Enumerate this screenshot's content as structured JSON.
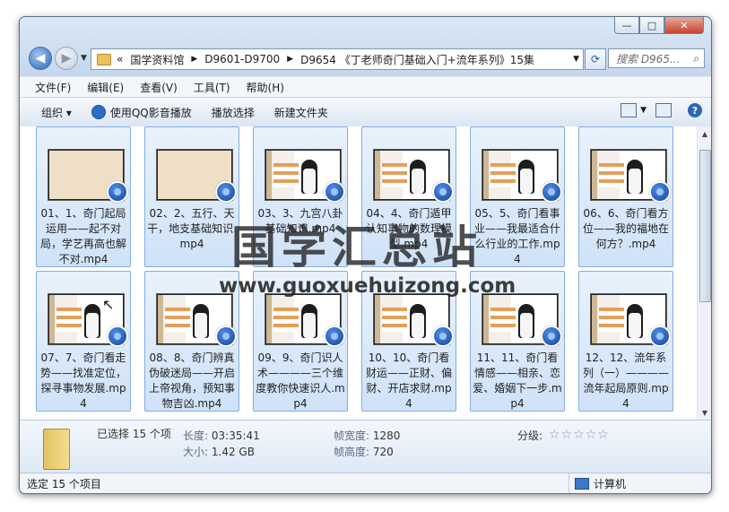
{
  "address": {
    "segments": [
      "«",
      "国学资料馆",
      "D9601-D9700",
      "D9654 《丁老师奇门基础入门+流年系列》15集"
    ],
    "search_placeholder": "搜索 D965..."
  },
  "menu": [
    "文件(F)",
    "编辑(E)",
    "查看(V)",
    "工具(T)",
    "帮助(H)"
  ],
  "toolbar": {
    "organize": "组织 ▾",
    "qq_play": "使用QQ影音播放",
    "playlist": "播放选择",
    "new_folder": "新建文件夹"
  },
  "files": [
    {
      "name": "01、1、奇门起局运用——起不对局，学艺再高也解不对.mp4",
      "thumb": "blank"
    },
    {
      "name": "02、2、五行、天干，地支基础知识.mp4",
      "thumb": "blank"
    },
    {
      "name": "03、3、九宫八卦基础知识.mp4",
      "thumb": "slide"
    },
    {
      "name": "04、4、奇门遁甲认知事物的数理模型.mp4",
      "thumb": "slide"
    },
    {
      "name": "05、5、奇门看事业——我最适合什么行业的工作.mp4",
      "thumb": "slide"
    },
    {
      "name": "06、6、奇门看方位——我的福地在何方？.mp4",
      "thumb": "slide"
    },
    {
      "name": "07、7、奇门看走势——找准定位，探寻事物发展.mp4",
      "thumb": "slide"
    },
    {
      "name": "08、8、奇门辨真伪破迷局——开启上帝视角，预知事物吉凶.mp4",
      "thumb": "slide"
    },
    {
      "name": "09、9、奇门识人术————三个维度教你快速识人.mp4",
      "thumb": "slide"
    },
    {
      "name": "10、10、奇门看财运——正财、偏财、开店求财.mp4",
      "thumb": "slide"
    },
    {
      "name": "11、11、奇门看情感——相亲、恋爱、婚姻下一步.mp4",
      "thumb": "slide"
    },
    {
      "name": "12、12、流年系列（一）————流年起局原则.mp4",
      "thumb": "slide"
    }
  ],
  "watermark": {
    "title": "国学汇总站",
    "url": "www.guoxuehuizong.com"
  },
  "details": {
    "selected": "已选择 15 个项",
    "length_label": "长度:",
    "length_value": "03:35:41",
    "size_label": "大小:",
    "size_value": "1.42 GB",
    "frame_width_label": "帧宽度:",
    "frame_width_value": "1280",
    "frame_height_label": "帧高度:",
    "frame_height_value": "720",
    "rating_label": "分级:",
    "rating_value": 0
  },
  "status": {
    "left": "选定 15 个项目",
    "right": "计算机"
  }
}
